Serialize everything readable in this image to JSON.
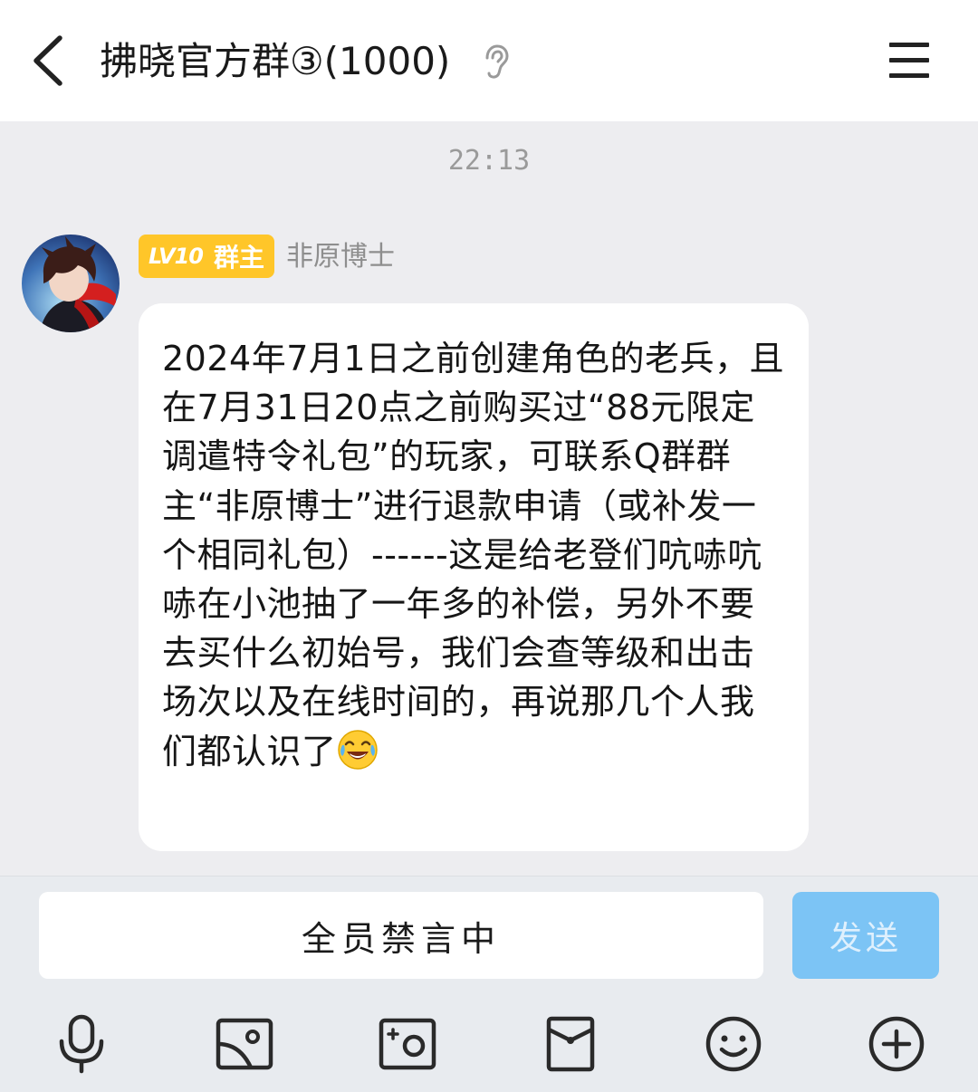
{
  "header": {
    "title": "拂晓官方群③(1000)",
    "back_icon": "chevron-left-icon",
    "ear_icon": "ear-icon",
    "menu_icon": "hamburger-menu-icon"
  },
  "chat": {
    "timestamp": "22:13",
    "message": {
      "level_badge": "LV10",
      "role_badge": "群主",
      "badge_color": "#ffc629",
      "sender_name": "非原博士",
      "text": "2024年7月1日之前创建角色的老兵，且在7月31日20点之前购买过“88元限定调遣特令礼包”的玩家，可联系Q群群主“非原博士”进行退款申请（或补发一个相同礼包）------这是给老登们吭哧吭哧在小池抽了一年多的补偿，另外不要去买什么初始号，我们会查等级和出击场次以及在线时间的，再说那几个人我们都认识了",
      "trailing_emoji": "laughing-tears-emoji"
    }
  },
  "input_bar": {
    "status_text": "全员禁言中",
    "send_label": "发送",
    "send_color": "#7cc4f5",
    "tools": [
      "microphone-icon",
      "image-icon",
      "camera-icon",
      "red-packet-icon",
      "emoji-icon",
      "plus-icon"
    ]
  }
}
